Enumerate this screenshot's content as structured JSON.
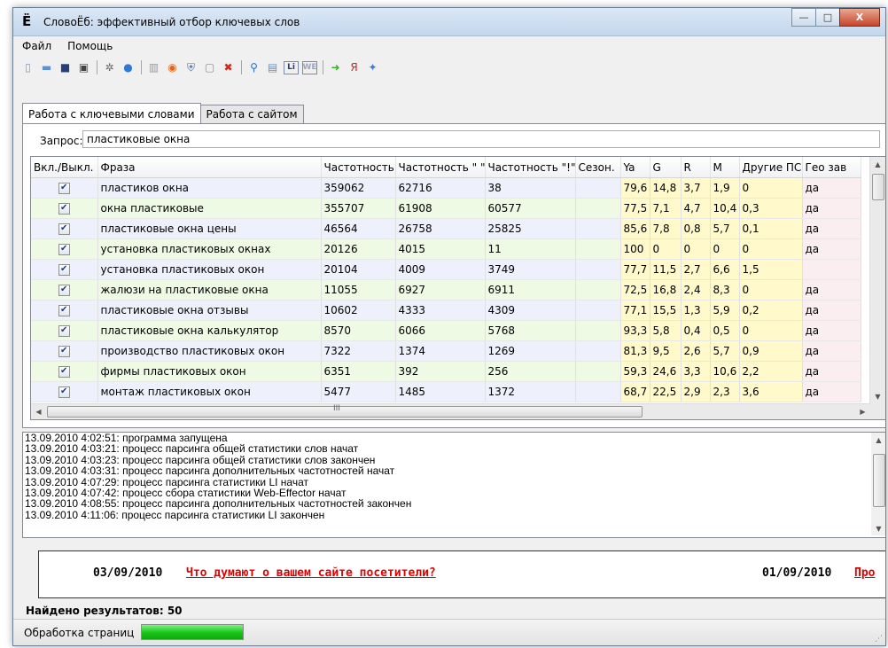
{
  "window": {
    "title": "СловоЁб: эффективный отбор ключевых слов",
    "app_icon": "Ё",
    "btn_min": "—",
    "btn_max": "□",
    "btn_close": "X"
  },
  "menu": [
    "Файл",
    "Помощь"
  ],
  "toolbar": [
    {
      "name": "new-doc-icon",
      "glyph": "▯",
      "color": "#6d9ad8"
    },
    {
      "name": "open-folder-icon",
      "glyph": "▬",
      "color": "#5b8fd6"
    },
    {
      "name": "save-icon",
      "glyph": "■",
      "color": "#263f7a"
    },
    {
      "name": "save-as-icon",
      "glyph": "▣",
      "color": "#444444"
    },
    {
      "sep": true
    },
    {
      "name": "gear-icon",
      "glyph": "✲",
      "color": "#666666"
    },
    {
      "name": "globe-icon",
      "glyph": "●",
      "color": "#2d7ad6"
    },
    {
      "sep": true
    },
    {
      "name": "stats-chart-icon",
      "glyph": "▥",
      "color": "#9a9a9a"
    },
    {
      "name": "lifebuoy-icon",
      "glyph": "◉",
      "color": "#e8641e"
    },
    {
      "name": "shield-icon",
      "glyph": "⛨",
      "color": "#3e6fc2"
    },
    {
      "name": "clipboard-icon",
      "glyph": "▢",
      "color": "#8a8a8a"
    },
    {
      "name": "delete-icon",
      "glyph": "✖",
      "color": "#d8261a"
    },
    {
      "sep": true
    },
    {
      "name": "search-icon",
      "glyph": "⚲",
      "color": "#1f6cc7"
    },
    {
      "name": "chart-window-icon",
      "glyph": "▤",
      "color": "#6c8fc0"
    },
    {
      "name": "li-icon",
      "glyph": "Li",
      "color": "#1d3f7a"
    },
    {
      "name": "web-effector-icon",
      "glyph": "WE",
      "color": "#9aa8c4"
    },
    {
      "sep": true
    },
    {
      "name": "arrow-right-icon",
      "glyph": "➜",
      "color": "#3cae2a"
    },
    {
      "name": "yandex-icon",
      "glyph": "Я",
      "color": "#e02020"
    },
    {
      "name": "google-icon",
      "glyph": "✦",
      "color": "#3b7de0"
    }
  ],
  "tabs": [
    "Работа с ключевыми словами",
    "Работа с сайтом"
  ],
  "query": {
    "label": "Запрос:",
    "value": "пластиковые окна"
  },
  "grid": {
    "columns": [
      "Вкл./Выкл.",
      "Фраза",
      "Частотность",
      "Частотность \" \"",
      "Частотность \"!\"",
      "Сезон.",
      "Ya",
      "G",
      "R",
      "M",
      "Другие ПС",
      "Гео зав"
    ],
    "rows": [
      {
        "checked": true,
        "phrase": "пластиков окна",
        "f1": "359062",
        "f2": "62716",
        "f3": "38",
        "season": "",
        "ya": "79,6",
        "g": "14,8",
        "r": "3,7",
        "m": "1,9",
        "other": "0",
        "geo": "да"
      },
      {
        "checked": true,
        "phrase": "окна пластиковые",
        "f1": "355707",
        "f2": "61908",
        "f3": "60577",
        "season": "",
        "ya": "77,5",
        "g": "7,1",
        "r": "4,7",
        "m": "10,4",
        "other": "0,3",
        "geo": "да"
      },
      {
        "checked": true,
        "phrase": "пластиковые окна цены",
        "f1": "46564",
        "f2": "26758",
        "f3": "25825",
        "season": "",
        "ya": "85,6",
        "g": "7,8",
        "r": "0,8",
        "m": "5,7",
        "other": "0,1",
        "geo": "да"
      },
      {
        "checked": true,
        "phrase": "установка пластиковых окнах",
        "f1": "20126",
        "f2": "4015",
        "f3": "11",
        "season": "",
        "ya": "100",
        "g": "0",
        "r": "0",
        "m": "0",
        "other": "0",
        "geo": "да"
      },
      {
        "checked": true,
        "phrase": "установка пластиковых окон",
        "f1": "20104",
        "f2": "4009",
        "f3": "3749",
        "season": "",
        "ya": "77,7",
        "g": "11,5",
        "r": "2,7",
        "m": "6,6",
        "other": "1,5",
        "geo": ""
      },
      {
        "checked": true,
        "phrase": "жалюзи на пластиковые окна",
        "f1": "11055",
        "f2": "6927",
        "f3": "6911",
        "season": "",
        "ya": "72,5",
        "g": "16,8",
        "r": "2,4",
        "m": "8,3",
        "other": "0",
        "geo": "да"
      },
      {
        "checked": true,
        "phrase": "пластиковые окна отзывы",
        "f1": "10602",
        "f2": "4333",
        "f3": "4309",
        "season": "",
        "ya": "77,1",
        "g": "15,5",
        "r": "1,3",
        "m": "5,9",
        "other": "0,2",
        "geo": "да"
      },
      {
        "checked": true,
        "phrase": "пластиковые окна калькулятор",
        "f1": "8570",
        "f2": "6066",
        "f3": "5768",
        "season": "",
        "ya": "93,3",
        "g": "5,8",
        "r": "0,4",
        "m": "0,5",
        "other": "0",
        "geo": "да"
      },
      {
        "checked": true,
        "phrase": "производство пластиковых окон",
        "f1": "7322",
        "f2": "1374",
        "f3": "1269",
        "season": "",
        "ya": "81,3",
        "g": "9,5",
        "r": "2,6",
        "m": "5,7",
        "other": "0,9",
        "geo": "да"
      },
      {
        "checked": true,
        "phrase": "фирмы пластиковых окон",
        "f1": "6351",
        "f2": "392",
        "f3": "256",
        "season": "",
        "ya": "59,3",
        "g": "24,6",
        "r": "3,3",
        "m": "10,6",
        "other": "2,2",
        "geo": "да"
      },
      {
        "checked": true,
        "phrase": "монтаж пластиковых окон",
        "f1": "5477",
        "f2": "1485",
        "f3": "1372",
        "season": "",
        "ya": "68,7",
        "g": "22,5",
        "r": "2,9",
        "m": "2,3",
        "other": "3,6",
        "geo": "да"
      }
    ],
    "hscroll_label": "III"
  },
  "log": [
    "13.09.2010 4:02:51: программа запущена",
    "13.09.2010 4:03:21: процесс парсинга общей статистики слов начат",
    "13.09.2010 4:03:23: процесс парсинга общей статистики слов закончен",
    "13.09.2010 4:03:31: процесс парсинга дополнительных частотностей начат",
    "13.09.2010 4:07:29: процесс парсинга статистики LI начат",
    "13.09.2010 4:07:42: процесс сбора статистики Web-Effector начат",
    "13.09.2010 4:08:55: процесс парсинга дополнительных частотностей закончен",
    "13.09.2010 4:11:06: процесс парсинга статистики LI закончен"
  ],
  "news": [
    {
      "date": "03/09/2010",
      "link": "Что думают о вашем сайте посетители?"
    },
    {
      "date": "01/09/2010",
      "link": "Про"
    }
  ],
  "found": "Найдено результатов: 50",
  "status": {
    "label": "Обработка страниц",
    "progress": 1.0
  },
  "colors": {
    "progress": "#18c318",
    "news_link": "#e00000",
    "row_odd": "#eef1fb",
    "row_even": "#eefae4",
    "metric": "#fff9cc"
  }
}
